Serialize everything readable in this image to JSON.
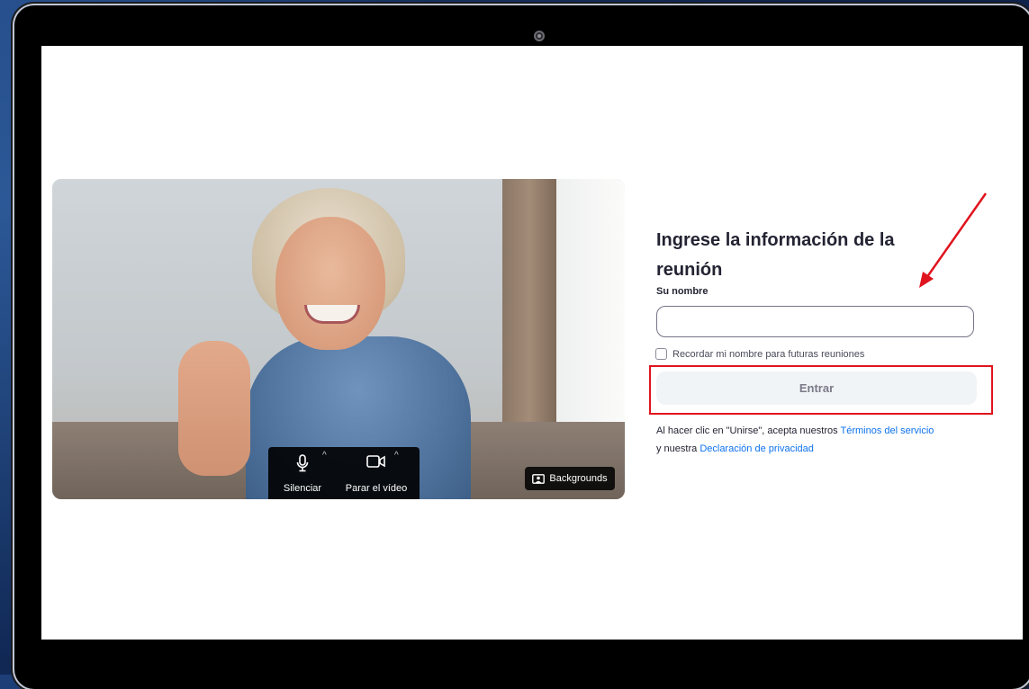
{
  "video": {
    "mute_label": "Silenciar",
    "stop_video_label": "Parar el vídeo",
    "backgrounds_label": "Backgrounds"
  },
  "form": {
    "title": "Ingrese la información de la reunión",
    "name_label": "Su nombre",
    "name_value": "",
    "remember_label": "Recordar mi nombre para futuras reuniones",
    "remember_checked": false,
    "join_label": "Entrar",
    "terms_prefix": "Al hacer clic en \"Unirse\", acepta nuestros",
    "terms_link": "Términos del servicio",
    "terms_mid": "y nuestra",
    "privacy_link": "Declaración de privacidad"
  },
  "annotations": {
    "highlight_color": "#e0141e",
    "arrow_color": "#e0141e"
  },
  "colors": {
    "accent_link": "#0e72ed",
    "button_bg": "#f1f4f6"
  }
}
